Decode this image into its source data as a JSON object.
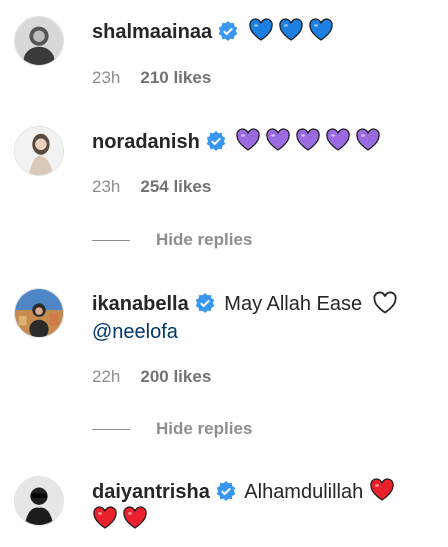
{
  "comments": [
    {
      "username": "shalmaainaa",
      "verified": true,
      "text": "",
      "hearts": {
        "count": 3,
        "color": "#1d7fe0"
      },
      "time": "23h",
      "likes": "210 likes"
    },
    {
      "username": "noradanish",
      "verified": true,
      "text": "",
      "hearts": {
        "count": 5,
        "color": "#9a6ae0"
      },
      "time": "23h",
      "likes": "254 likes",
      "hide_replies": "Hide replies"
    },
    {
      "username": "ikanabella",
      "verified": true,
      "text": "May Allah Ease",
      "mention": "@neelofa",
      "time": "22h",
      "likes": "200 likes",
      "hide_replies": "Hide replies"
    },
    {
      "username": "daiyantrisha",
      "verified": true,
      "text": "Alhamdulillah",
      "hearts": {
        "count": 3,
        "color": "#e8212d"
      }
    }
  ],
  "colors": {
    "verified": "#3897f0",
    "username": "#262626",
    "meta": "#8e8e8e",
    "mention": "#00376b"
  },
  "icons": {
    "verified": "verified-badge-icon",
    "like": "heart-outline-icon",
    "avatar": "avatar"
  }
}
